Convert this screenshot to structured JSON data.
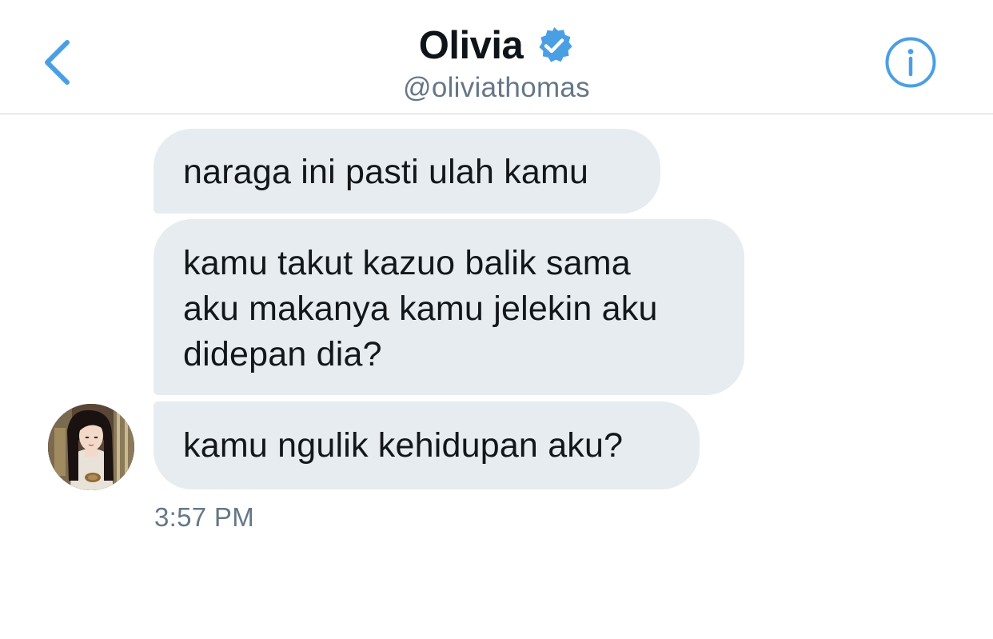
{
  "header": {
    "name": "Olivia",
    "handle": "@oliviathomas",
    "verified": true,
    "back_icon": "chevron-left-icon",
    "info_icon": "info-circle-icon",
    "accent_color": "#4a9fe4"
  },
  "messages": [
    {
      "sender": "other",
      "text": "naraga ini pasti ulah kamu"
    },
    {
      "sender": "other",
      "text": "kamu takut kazuo balik sama\naku makanya kamu jelekin aku\ndidepan dia?"
    },
    {
      "sender": "other",
      "text": "kamu ngulik kehidupan aku?"
    }
  ],
  "timestamp": "3:57 PM",
  "colors": {
    "bubble_bg": "#e6ecf0",
    "text": "#14171a",
    "secondary_text": "#657786",
    "divider": "#cfd3d7"
  }
}
